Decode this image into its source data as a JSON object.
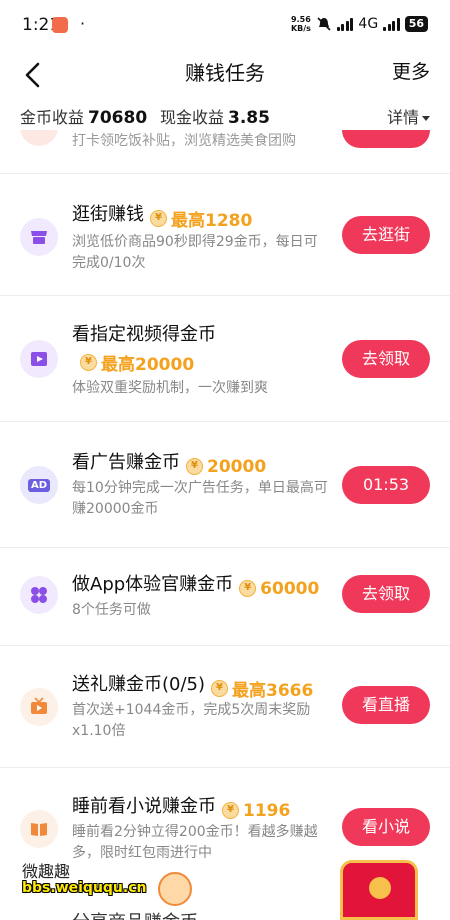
{
  "status_bar": {
    "time": "1:21",
    "dot": "·",
    "net_speed_value": "9.56",
    "net_speed_unit": "KB/s",
    "network": "4G",
    "battery": "56"
  },
  "header": {
    "title": "赚钱任务",
    "more_label": "更多"
  },
  "earnings": {
    "coin_label": "金币收益",
    "coin_value": "70680",
    "cash_label": "现金收益",
    "cash_value": "3.85",
    "details_label": "详情"
  },
  "partial_top": {
    "desc": "打卡领吃饭补贴，浏览精选美食团购"
  },
  "tasks": [
    {
      "title": "逛街赚钱",
      "reward": "最高1280",
      "desc": "浏览低价商品90秒即得29金币，每日可完成0/10次",
      "button": "去逛街",
      "icon": "shop-icon"
    },
    {
      "title": "看指定视频得金币",
      "reward": "最高20000",
      "desc": "体验双重奖励机制，一次赚到爽",
      "button": "去领取",
      "icon": "video-icon"
    },
    {
      "title": "看广告赚金币",
      "reward": "20000",
      "desc": "每10分钟完成一次广告任务，单日最高可赚20000金币",
      "button": "01:53",
      "icon": "ad-icon",
      "icon_text": "AD"
    },
    {
      "title": "做App体验官赚金币",
      "reward": "60000",
      "desc": "8个任务可做",
      "button": "去领取",
      "icon": "clover-icon"
    },
    {
      "title": "送礼赚金币(0/5)",
      "reward": "最高3666",
      "desc": "首次送+1044金币，完成5次周末奖励x1.10倍",
      "button": "看直播",
      "icon": "tv-icon"
    },
    {
      "title": "睡前看小说赚金币",
      "reward": "1196",
      "desc": "睡前看2分钟立得200金币！看越多赚越多，限时红包雨进行中",
      "button": "看小说",
      "icon": "book-icon"
    }
  ],
  "coin_symbol": "¥",
  "watermark": {
    "text": "微趣趣",
    "site": "bbs.weiququ.cn"
  },
  "bottom_partial": "分享商品赚金币",
  "colors": {
    "accent": "#f0395a",
    "reward": "#f4a21e"
  }
}
